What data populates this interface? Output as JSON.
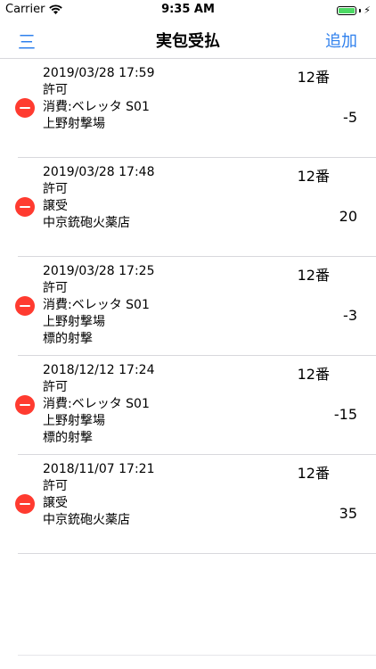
{
  "status_bar": {
    "carrier": "Carrier",
    "time": "9:35 AM",
    "charging_icon": "⚡"
  },
  "nav": {
    "menu_label": "三",
    "title": "実包受払",
    "add_label": "追加"
  },
  "colors": {
    "accent": "#2f80ed",
    "delete": "#ff3b30",
    "battery": "#4cd964"
  },
  "entries": [
    {
      "datetime": "2019/03/28 17:59",
      "status": "許可",
      "detail1": "消費:ベレッタ S01",
      "detail2": "上野射撃場",
      "detail3": "",
      "slot": "12番",
      "quantity": "-5"
    },
    {
      "datetime": "2019/03/28 17:48",
      "status": "許可",
      "detail1": "譲受",
      "detail2": "中京銃砲火薬店",
      "detail3": "",
      "slot": "12番",
      "quantity": "20"
    },
    {
      "datetime": "2019/03/28 17:25",
      "status": "許可",
      "detail1": "消費:ベレッタ S01",
      "detail2": "上野射撃場",
      "detail3": "標的射撃",
      "slot": "12番",
      "quantity": "-3"
    },
    {
      "datetime": "2018/12/12 17:24",
      "status": "許可",
      "detail1": "消費:ベレッタ S01",
      "detail2": "上野射撃場",
      "detail3": "標的射撃",
      "slot": "12番",
      "quantity": "-15"
    },
    {
      "datetime": "2018/11/07 17:21",
      "status": "許可",
      "detail1": "譲受",
      "detail2": "中京銃砲火薬店",
      "detail3": "",
      "slot": "12番",
      "quantity": "35"
    }
  ]
}
